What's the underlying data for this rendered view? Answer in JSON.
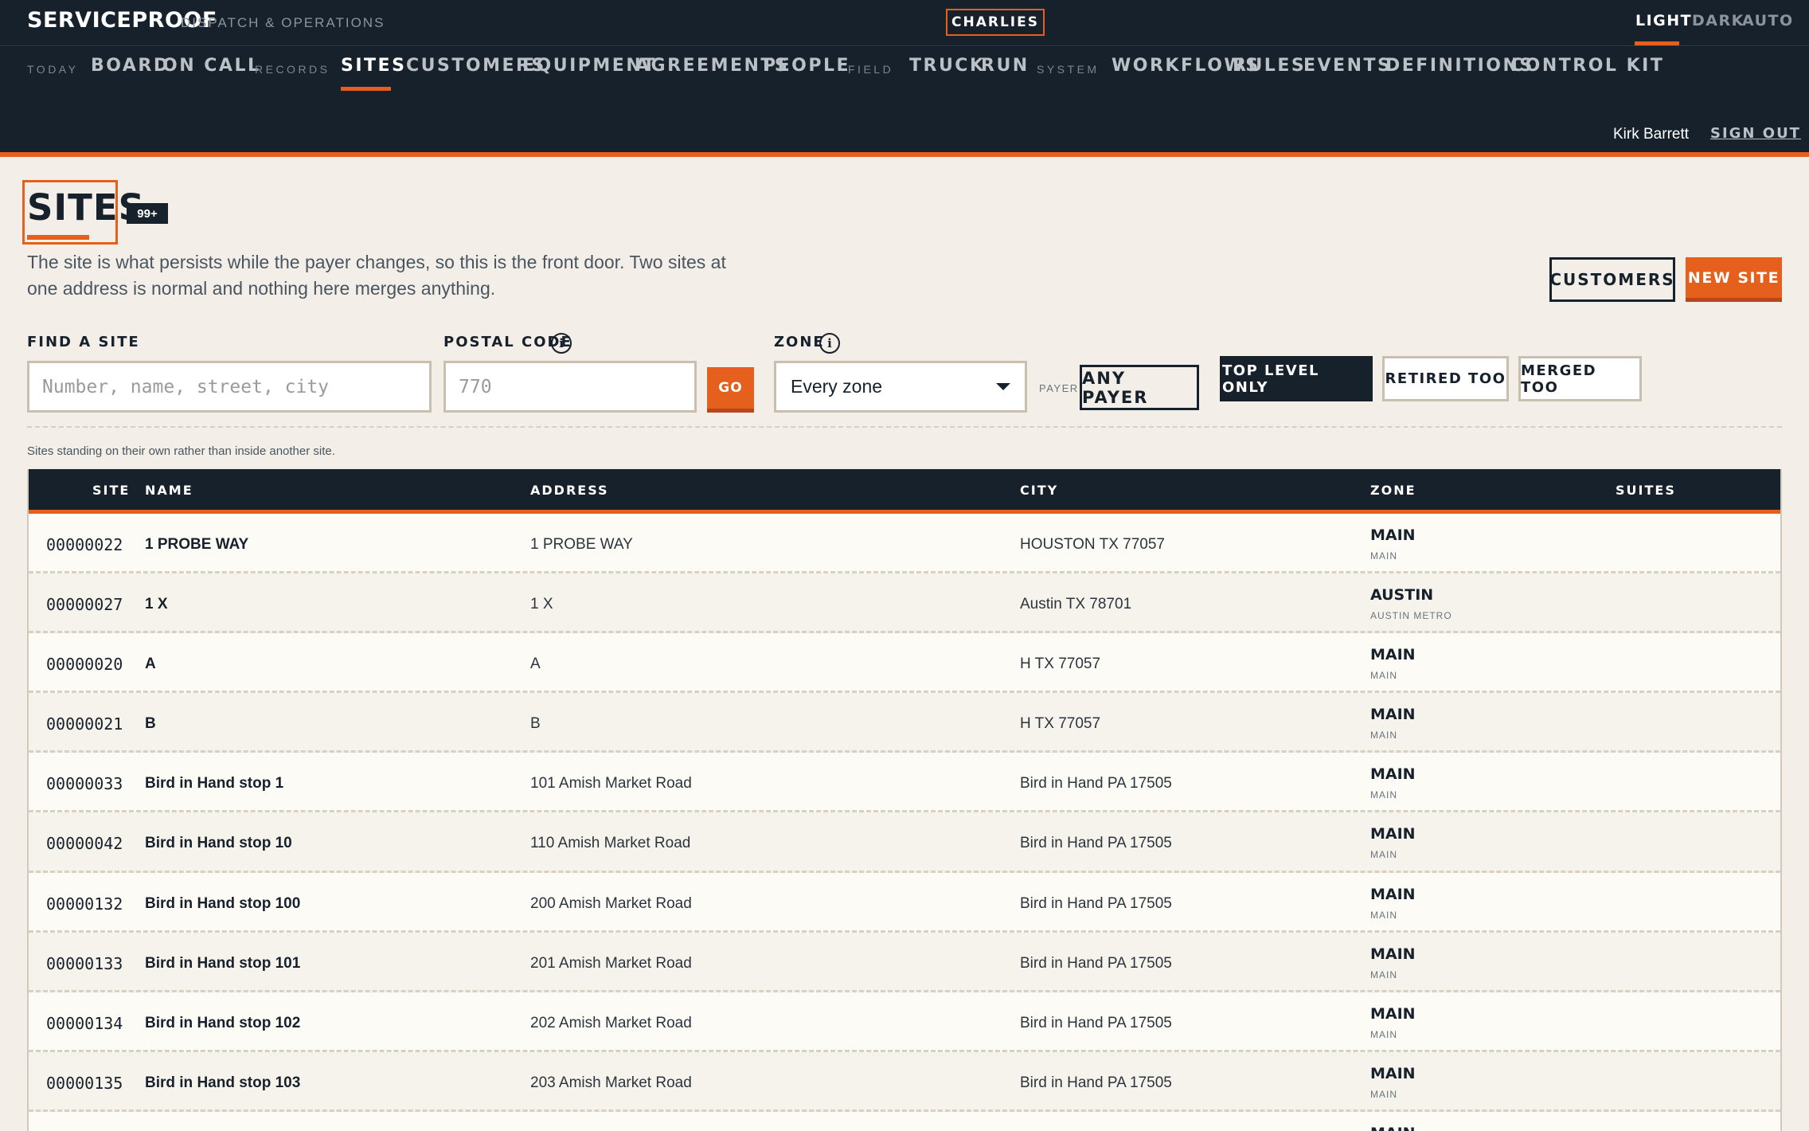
{
  "app": {
    "brand": "SERVICEPROOF",
    "subtitle": "DISPATCH & OPERATIONS",
    "tenant": "CHARLIES",
    "theme": [
      "LIGHT",
      "DARK",
      "AUTO"
    ]
  },
  "nav": {
    "groups": {
      "today": "TODAY",
      "records": "RECORDS",
      "field": "FIELD",
      "system": "SYSTEM"
    },
    "today": [
      "BOARD",
      "ON CALL"
    ],
    "records": [
      "SITES",
      "CUSTOMERS",
      "EQUIPMENT",
      "AGREEMENTS",
      "PEOPLE"
    ],
    "field": [
      "TRUCK",
      "RUN"
    ],
    "system": [
      "WORKFLOWS",
      "RULES",
      "EVENTS",
      "DEFINITIONS",
      "CONTROL KIT"
    ],
    "active": "SITES"
  },
  "user": {
    "name": "Kirk Barrett",
    "signout": "SIGN OUT"
  },
  "page": {
    "title": "SITES",
    "count": "99+",
    "intro": "The site is what persists while the payer changes, so this is the front door. Two sites at one address is normal and nothing here merges anything.",
    "customers_button": "CUSTOMERS",
    "new_button": "NEW SITE"
  },
  "filters": {
    "find_label": "FIND A SITE",
    "find_placeholder": "Number, name, street, city",
    "postal_label": "POSTAL CODE",
    "postal_placeholder": "770",
    "go": "GO",
    "zone_label": "ZONE",
    "zone_value": "Every zone",
    "payer_label": "PAYER",
    "payer_value": "ANY PAYER",
    "toggles": [
      {
        "label": "TOP LEVEL ONLY",
        "on": true
      },
      {
        "label": "RETIRED TOO",
        "on": false
      },
      {
        "label": "MERGED TOO",
        "on": false
      }
    ],
    "hint": "Sites standing on their own rather than inside another site."
  },
  "table": {
    "columns": [
      "SITE",
      "NAME",
      "ADDRESS",
      "CITY",
      "ZONE",
      "SUITES"
    ],
    "rows": [
      {
        "site": "00000022",
        "name": "1 PROBE WAY",
        "address": "1 PROBE WAY",
        "city": "HOUSTON TX 77057",
        "zone": "MAIN",
        "zone_sub": "MAIN"
      },
      {
        "site": "00000027",
        "name": "1 X",
        "address": "1 X",
        "city": "Austin TX 78701",
        "zone": "AUSTIN",
        "zone_sub": "AUSTIN METRO"
      },
      {
        "site": "00000020",
        "name": "A",
        "address": "A",
        "city": "H TX 77057",
        "zone": "MAIN",
        "zone_sub": "MAIN"
      },
      {
        "site": "00000021",
        "name": "B",
        "address": "B",
        "city": "H TX 77057",
        "zone": "MAIN",
        "zone_sub": "MAIN"
      },
      {
        "site": "00000033",
        "name": "Bird in Hand stop 1",
        "address": "101 Amish Market Road",
        "city": "Bird in Hand PA 17505",
        "zone": "MAIN",
        "zone_sub": "MAIN"
      },
      {
        "site": "00000042",
        "name": "Bird in Hand stop 10",
        "address": "110 Amish Market Road",
        "city": "Bird in Hand PA 17505",
        "zone": "MAIN",
        "zone_sub": "MAIN"
      },
      {
        "site": "00000132",
        "name": "Bird in Hand stop 100",
        "address": "200 Amish Market Road",
        "city": "Bird in Hand PA 17505",
        "zone": "MAIN",
        "zone_sub": "MAIN"
      },
      {
        "site": "00000133",
        "name": "Bird in Hand stop 101",
        "address": "201 Amish Market Road",
        "city": "Bird in Hand PA 17505",
        "zone": "MAIN",
        "zone_sub": "MAIN"
      },
      {
        "site": "00000134",
        "name": "Bird in Hand stop 102",
        "address": "202 Amish Market Road",
        "city": "Bird in Hand PA 17505",
        "zone": "MAIN",
        "zone_sub": "MAIN"
      },
      {
        "site": "00000135",
        "name": "Bird in Hand stop 103",
        "address": "203 Amish Market Road",
        "city": "Bird in Hand PA 17505",
        "zone": "MAIN",
        "zone_sub": "MAIN"
      },
      {
        "site": "",
        "name": "",
        "address": "",
        "city": "",
        "zone": "MAIN",
        "zone_sub": ""
      }
    ]
  }
}
